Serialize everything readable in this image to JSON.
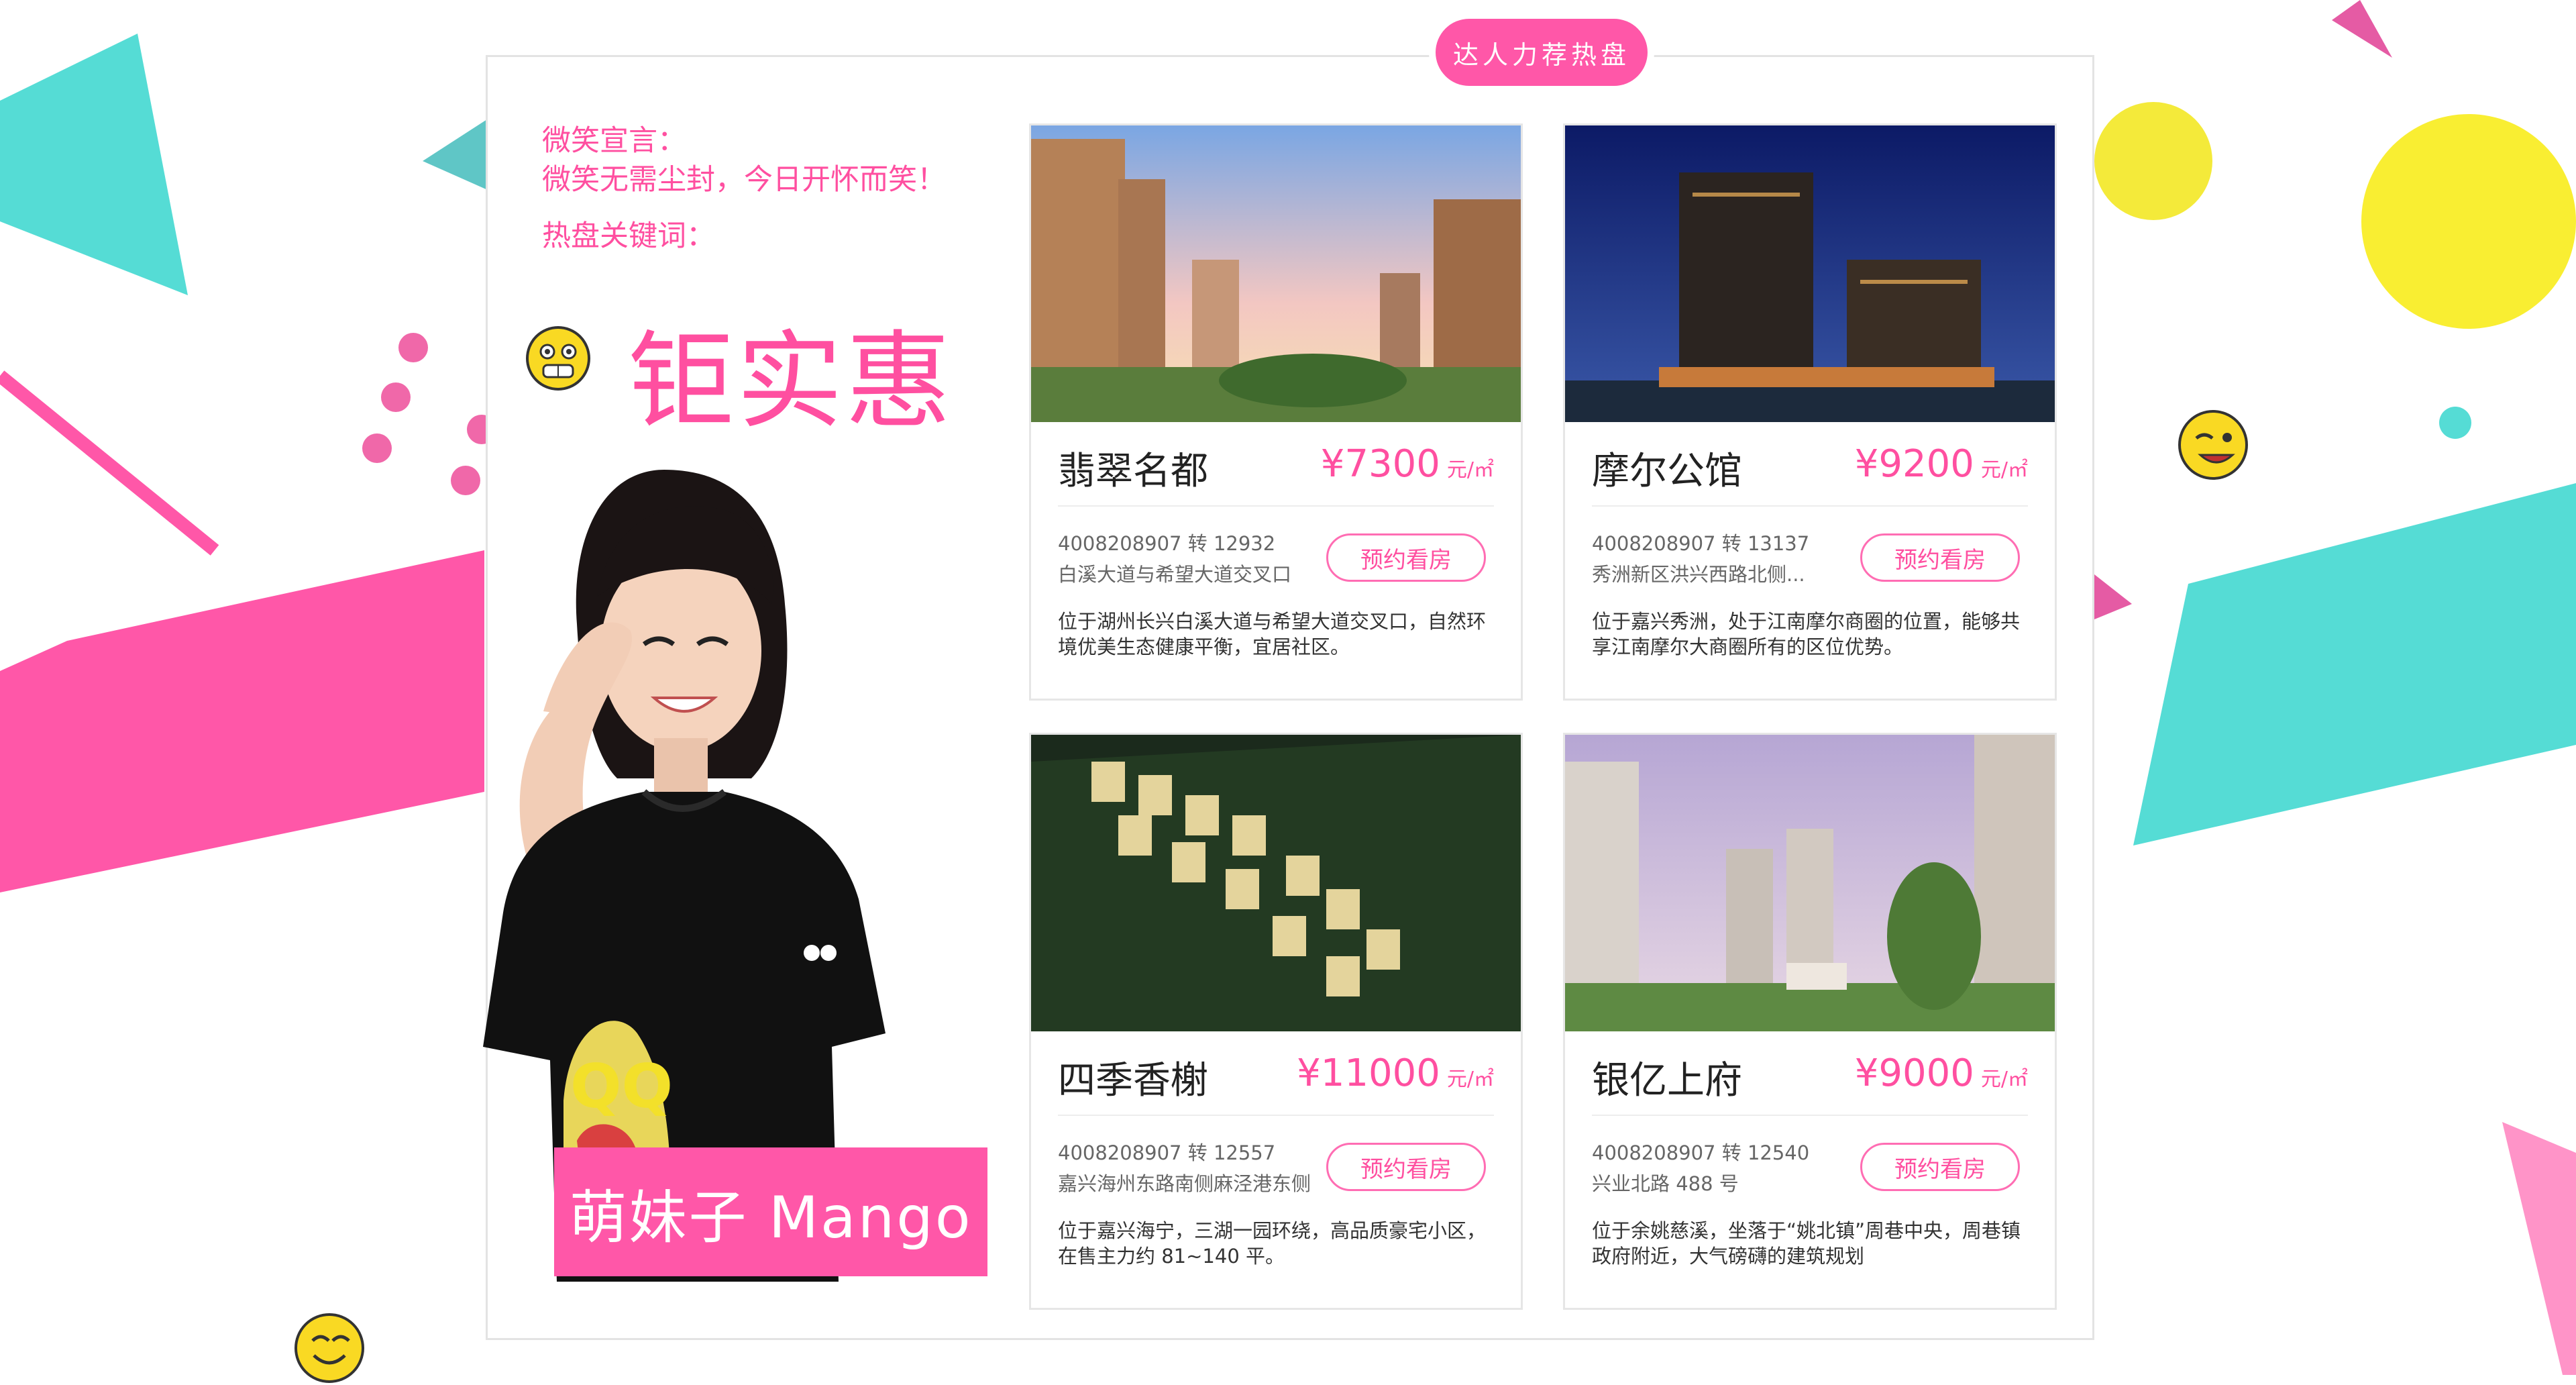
{
  "badge": "达人力荐热盘",
  "manifesto": {
    "label": "微笑宣言：",
    "text": "微笑无需尘封，今日开怀而笑！",
    "keyword_label": "热盘关键词：",
    "keyword": "钜实惠"
  },
  "presenter": {
    "name": "萌妹子 Mango"
  },
  "cards": [
    {
      "name": "翡翠名都",
      "price": "¥7300",
      "unit": "元/㎡",
      "phone": "4008208907 转 12932",
      "address": "白溪大道与希望大道交叉口",
      "button": "预约看房",
      "desc": "位于湖州长兴白溪大道与希望大道交叉口，自然环境优美生态健康平衡，宜居社区。"
    },
    {
      "name": "摩尔公馆",
      "price": "¥9200",
      "unit": "元/㎡",
      "phone": "4008208907 转 13137",
      "address": "秀洲新区洪兴西路北侧...",
      "button": "预约看房",
      "desc": "位于嘉兴秀洲，处于江南摩尔商圈的位置，能够共享江南摩尔大商圈所有的区位优势。"
    },
    {
      "name": "四季香榭",
      "price": "¥11000",
      "unit": "元/㎡",
      "phone": "4008208907 转 12557",
      "address": "嘉兴海州东路南侧麻泾港东侧",
      "button": "预约看房",
      "desc": "位于嘉兴海宁，三湖一园环绕，高品质豪宅小区，在售主力约 81~140 平。"
    },
    {
      "name": "银亿上府",
      "price": "¥9000",
      "unit": "元/㎡",
      "phone": "4008208907 转 12540",
      "address": "兴业北路 488 号",
      "button": "预约看房",
      "desc": "位于余姚慈溪，坐落于“姚北镇”周巷中央，周巷镇政府附近，大气磅礴的建筑规划"
    }
  ],
  "colors": {
    "pink": "#ff57a8",
    "teal": "#55dcd5",
    "yellow": "#f9ee32"
  },
  "icons": [
    "grin-emoji-icon",
    "wink-emoji-icon",
    "smile-emoji-icon"
  ]
}
